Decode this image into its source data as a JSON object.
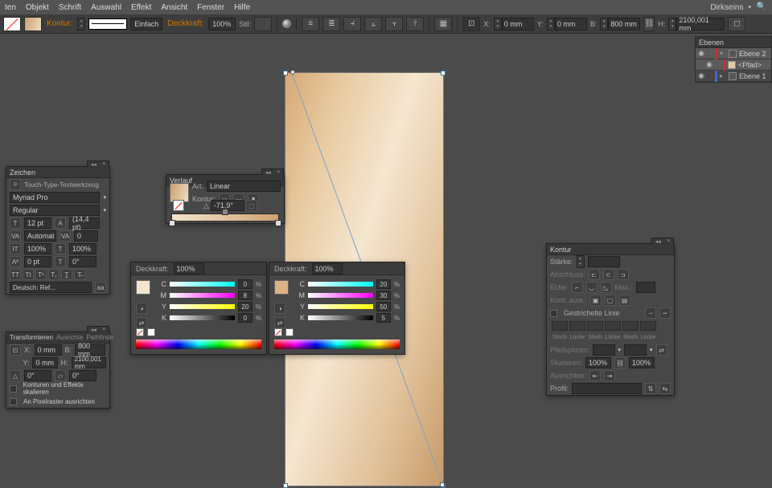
{
  "menubar": {
    "items": [
      "ten",
      "Objekt",
      "Schrift",
      "Auswahl",
      "Effekt",
      "Ansicht",
      "Fenster",
      "Hilfe"
    ],
    "workspace": "Dirkseins"
  },
  "controlbar": {
    "kontur_label": "Kontur:",
    "stroke_weight_label": "Einfach",
    "opacity_label": "Deckkraft:",
    "opacity_value": "100%",
    "style_label": "Stil:",
    "x_label": "X:",
    "x_value": "0 mm",
    "y_label": "Y:",
    "y_value": "0 mm",
    "w_label": "B:",
    "w_value": "800 mm",
    "h_label": "H:",
    "h_value": "2100,001 mm"
  },
  "layers": {
    "title": "Ebenen",
    "rows": [
      {
        "name": "Ebene 2",
        "color": "#cc2f2f",
        "sel": true
      },
      {
        "name": "<Pfad>",
        "color": "#cc2f2f",
        "sel": true,
        "indent": true
      },
      {
        "name": "Ebene 1",
        "color": "#3a6bd1",
        "sel": false
      }
    ]
  },
  "zeichen": {
    "title": "Zeichen",
    "tool_label": "Touch-Type-Textwerkzeug",
    "font": "Myriad Pro",
    "style": "Regular",
    "size": "12 pt",
    "leading": "(14,4 pt)",
    "kerning": "Automat",
    "tracking": "0",
    "hscale": "100%",
    "vscale": "100%",
    "baseline": "0 pt",
    "rotate": "0°",
    "lang": "Deutsch: Ref..."
  },
  "verlauf": {
    "title": "Verlauf",
    "art_label": "Art:",
    "art_value": "Linear",
    "kontur_label": "Kontur:",
    "angle_icon": "△",
    "angle_value": "-71,9°",
    "stops": [
      0,
      50,
      100
    ]
  },
  "stop_left": {
    "title": "Deckkraft:",
    "opacity": "100%",
    "swatch": "#f3e5cd",
    "cmyk": [
      {
        "k": "C",
        "v": "0"
      },
      {
        "k": "M",
        "v": "8"
      },
      {
        "k": "Y",
        "v": "20"
      },
      {
        "k": "K",
        "v": "0"
      }
    ]
  },
  "stop_right": {
    "title": "Deckkraft:",
    "opacity": "100%",
    "swatch": "#dcb184",
    "cmyk": [
      {
        "k": "C",
        "v": "20"
      },
      {
        "k": "M",
        "v": "30"
      },
      {
        "k": "Y",
        "v": "50"
      },
      {
        "k": "K",
        "v": "5"
      }
    ]
  },
  "transform": {
    "tabs": [
      "Transformieren",
      "Ausrichte",
      "Pathfinde"
    ],
    "x_label": "X:",
    "x_value": "0 mm",
    "b_label": "B:",
    "b_value": "800 mm",
    "y_label": "Y:",
    "y_value": "0 mm",
    "h_label": "H:",
    "h_value": "2100,001 mm",
    "angle": "0°",
    "shear": "0°",
    "opt1": "Konturen und Effekte skalieren",
    "opt2": "An Pixelraster ausrichten"
  },
  "kontur": {
    "title": "Kontur",
    "weight_label": "Stärke:",
    "cap_label": "Abschluss:",
    "corner_label": "Ecke:",
    "limit_label": "Max.:",
    "align_label": "Kont. ausr.:",
    "dash_label": "Gestrichelte Linie",
    "dash_cols": [
      "Strich",
      "Lücke",
      "Strich",
      "Lücke",
      "Strich",
      "Lücke"
    ],
    "arrow_label": "Pfeilspitzen:",
    "scale_label": "Skalieren:",
    "scale1": "100%",
    "scale2": "100%",
    "alignarrow_label": "Ausrichten:",
    "profile_label": "Profil:"
  }
}
